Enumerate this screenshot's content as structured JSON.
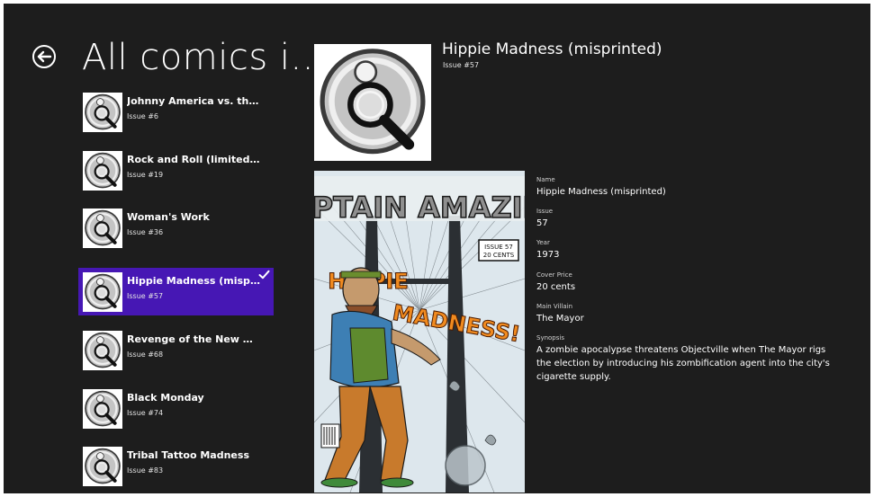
{
  "page": {
    "title": "All comics i..."
  },
  "comics": [
    {
      "title": "Johnny America vs. the Pinko",
      "issue": "Issue #6"
    },
    {
      "title": "Rock and Roll (limited edition)",
      "issue": "Issue #19"
    },
    {
      "title": "Woman's Work",
      "issue": "Issue #36"
    },
    {
      "title": "Hippie Madness (misprinted)",
      "issue": "Issue #57"
    },
    {
      "title": "Revenge of the New Wave Freaks (damaged)",
      "issue": "Issue #68"
    },
    {
      "title": "Black Monday",
      "issue": "Issue #74"
    },
    {
      "title": "Tribal Tattoo Madness",
      "issue": "Issue #83"
    }
  ],
  "selected_index": 3,
  "detail": {
    "title": "Hippie Madness (misprinted)",
    "issue": "Issue #57",
    "cover": {
      "series": "CAPTAIN AMAZING",
      "title": "HIPPIE MADNESS!",
      "issue_box": "ISSUE 57",
      "price_box": "20 CENTS"
    },
    "fields": [
      {
        "label": "Name",
        "value": "Hippie Madness (misprinted)"
      },
      {
        "label": "Issue",
        "value": "57"
      },
      {
        "label": "Year",
        "value": "1973"
      },
      {
        "label": "Cover Price",
        "value": "20 cents"
      },
      {
        "label": "Main Villain",
        "value": "The Mayor"
      },
      {
        "label": "Synopsis",
        "value": "A zombie apocalypse threatens Objectville when The Mayor rigs the election by introducing his zombification agent into the city's cigarette supply."
      }
    ]
  },
  "colors": {
    "background": "#1d1d1d",
    "accent": "#4617b4",
    "text": "#ffffff"
  },
  "icons": {
    "back": "back-arrow-icon",
    "check": "checkmark-icon",
    "thumbnail": "magnifier-placeholder-icon"
  }
}
